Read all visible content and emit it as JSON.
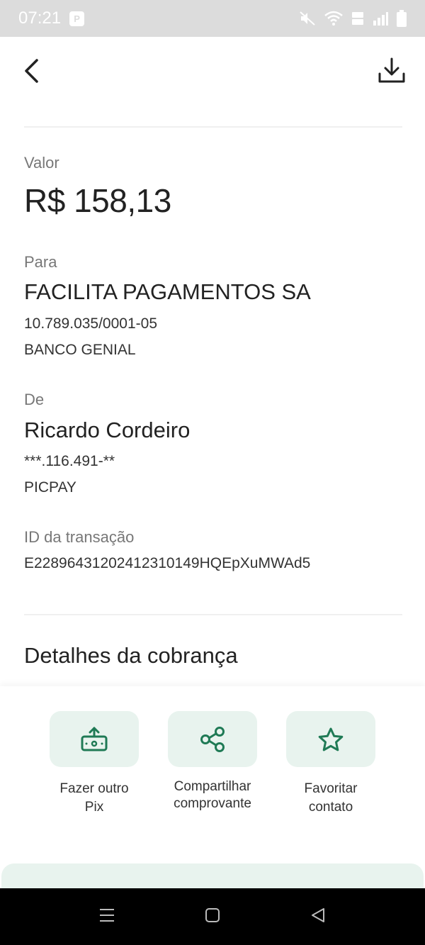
{
  "status_bar": {
    "time": "07:21",
    "app_badge": "P"
  },
  "amount": {
    "label": "Valor",
    "value": "R$ 158,13"
  },
  "recipient": {
    "label": "Para",
    "name": "FACILITA PAGAMENTOS SA",
    "document": "10.789.035/0001-05",
    "bank": "BANCO GENIAL"
  },
  "sender": {
    "label": "De",
    "name": "Ricardo Cordeiro",
    "document": "***.116.491-**",
    "bank": "PICPAY"
  },
  "transaction": {
    "label": "ID da transação",
    "id": "E22896431202412310149HQEpXuMWAd5"
  },
  "details": {
    "title": "Detalhes da cobrança"
  },
  "actions": {
    "new_pix": {
      "line1": "Fazer outro",
      "line2": "Pix"
    },
    "share": {
      "line1": "Compartilhar",
      "line2": "comprovante"
    },
    "favorite": {
      "line1": "Favoritar",
      "line2": "contato"
    }
  },
  "colors": {
    "accent": "#1f7a55",
    "action_bg": "#e8f3ee",
    "status_bar_bg": "#dcdcdc"
  },
  "icons": {
    "back": "chevron-left-icon",
    "download": "download-icon",
    "new_pix": "money-upload-icon",
    "share": "share-icon",
    "favorite": "star-icon"
  }
}
